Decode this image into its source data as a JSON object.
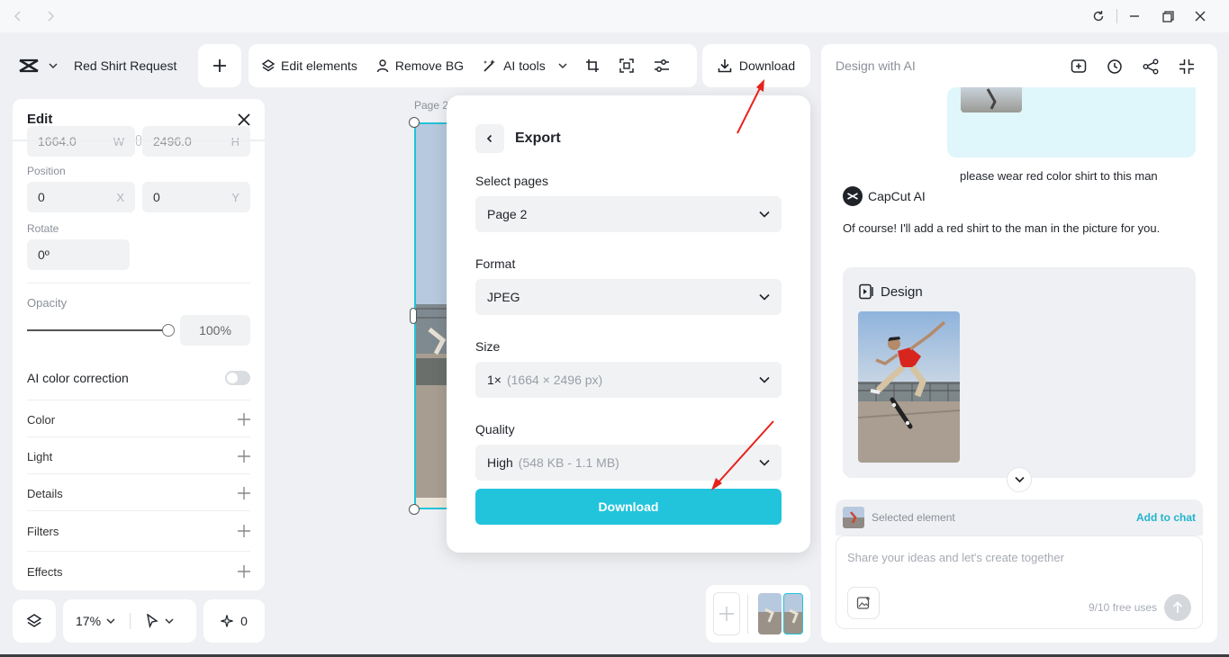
{
  "project": {
    "name": "Red Shirt Request"
  },
  "toolbar": {
    "edit_elements": "Edit elements",
    "remove_bg": "Remove BG",
    "ai_tools": "AI tools",
    "download": "Download"
  },
  "edit_panel": {
    "title": "Edit",
    "width_value": "1664.0",
    "width_suffix": "W",
    "height_value": "2496.0",
    "height_suffix": "H",
    "position_label": "Position",
    "pos_x": "0",
    "pos_x_suffix": "X",
    "pos_y": "0",
    "pos_y_suffix": "Y",
    "rotate_label": "Rotate",
    "rotate_value": "0º",
    "opacity_label": "Opacity",
    "opacity_value": "100%",
    "opacity_level": 1.0,
    "ai_color_correction": "AI color correction",
    "sections": [
      "Color",
      "Light",
      "Details",
      "Filters",
      "Effects"
    ]
  },
  "bottom_controls": {
    "zoom": "17%",
    "magic_count": "0"
  },
  "canvas": {
    "page_label": "Page 2"
  },
  "export": {
    "title": "Export",
    "pages_label": "Select pages",
    "pages_value": "Page 2",
    "format_label": "Format",
    "format_value": "JPEG",
    "size_label": "Size",
    "size_value": "1×",
    "size_detail": "(1664 × 2496 px)",
    "quality_label": "Quality",
    "quality_value": "High",
    "quality_detail": "(548 KB - 1.1 MB)",
    "download_label": "Download"
  },
  "ai_panel": {
    "header": "Design with AI",
    "user_message": "please wear red color shirt to this man",
    "ai_name": "CapCut AI",
    "ai_reply": "Of course! I'll add a red shirt to the man in the picture for you.",
    "design_title": "Design",
    "selected_element": "Selected element",
    "add_to_chat": "Add to chat",
    "input_placeholder": "Share your ideas and let's create together",
    "free_uses": "9/10 free uses"
  },
  "colors": {
    "accent": "#22c4dc",
    "arrow": "#e8221b"
  }
}
